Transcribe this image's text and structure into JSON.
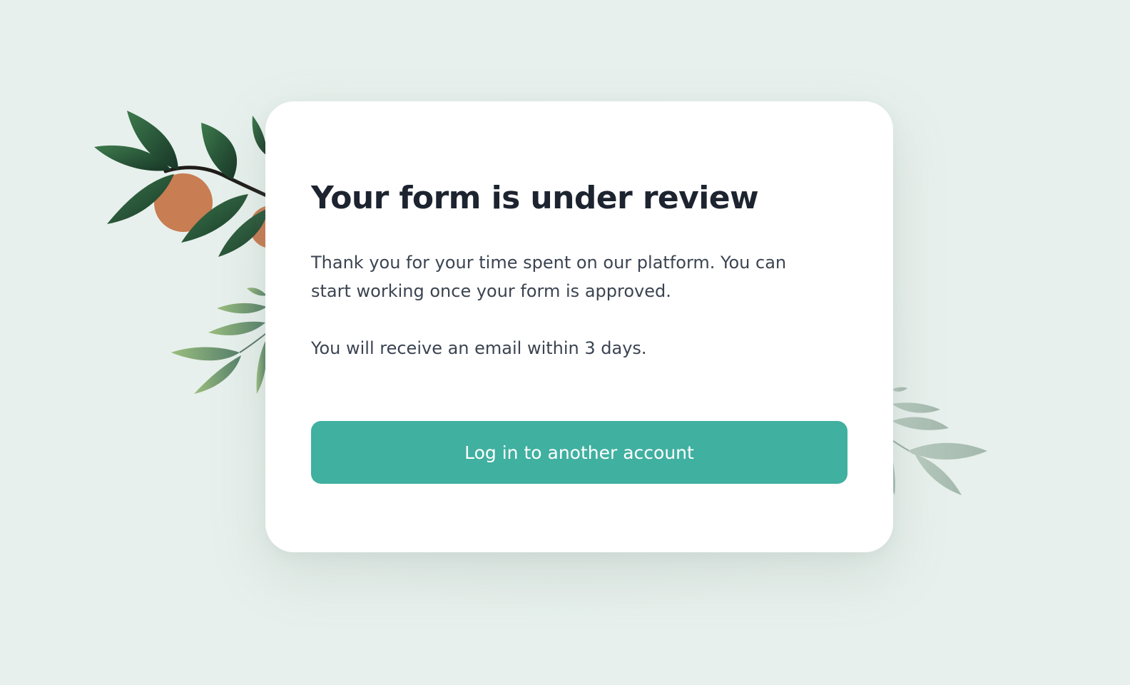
{
  "card": {
    "title": "Your form is under review",
    "description": "Thank you for your time spent on our platform. You can start working once your form is approved.",
    "note": "You will receive an email within 3 days.",
    "button_label": "Log in to another account"
  },
  "colors": {
    "background": "#e7f0ec",
    "card": "#ffffff",
    "accent": "#40b0a0",
    "title": "#1d2430",
    "body_text": "#3b4451",
    "orange": "#c97d52",
    "leaf_dark": "#27553a"
  },
  "decorations": {
    "top_left": "orange-branch-illustration",
    "mid_left": "olive-branch-illustration",
    "right": "faded-olive-branch-illustration"
  }
}
